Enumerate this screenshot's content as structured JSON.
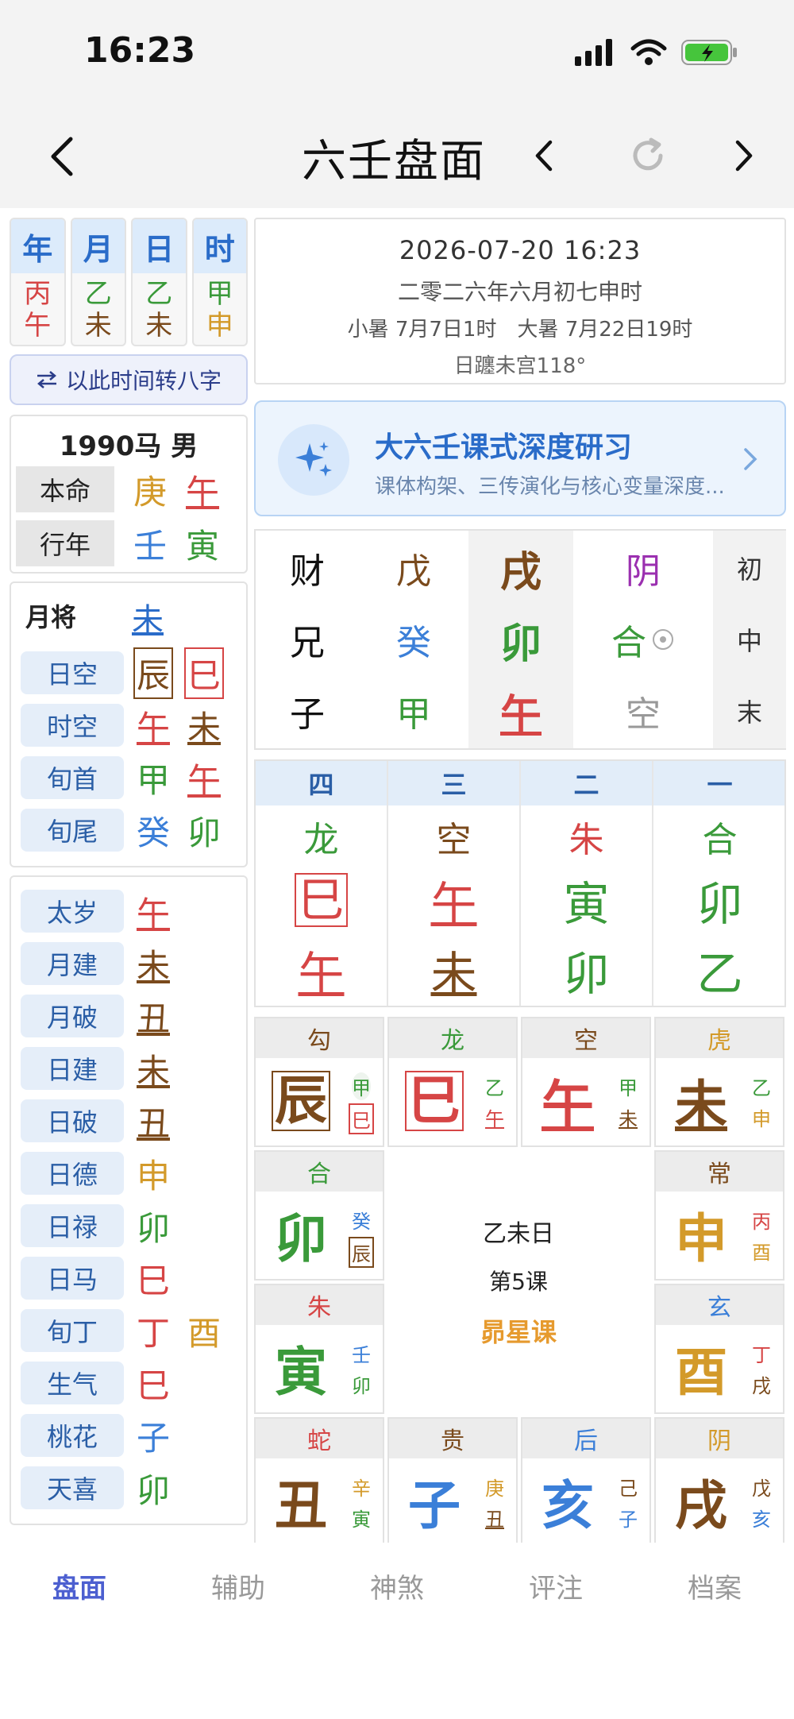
{
  "status": {
    "time": "16:23"
  },
  "nav": {
    "title": "六壬盘面"
  },
  "pillars": [
    {
      "head": "年",
      "gan": "丙",
      "zhi": "午",
      "gan_color": "#d64545",
      "zhi_color": "#d64545"
    },
    {
      "head": "月",
      "gan": "乙",
      "zhi": "未",
      "gan_color": "#3a9a3a",
      "zhi_color": "#7a4a1c"
    },
    {
      "head": "日",
      "gan": "乙",
      "zhi": "未",
      "gan_color": "#3a9a3a",
      "zhi_color": "#7a4a1c"
    },
    {
      "head": "时",
      "gan": "甲",
      "zhi": "申",
      "gan_color": "#3a9a3a",
      "zhi_color": "#d39a2a"
    }
  ],
  "convert_label": "以此时间转八字",
  "birth": {
    "title": "1990马 男",
    "rows": [
      {
        "label": "本命",
        "v1": "庚",
        "v2": "午",
        "c1": "#d39a2a",
        "c2": "#d64545"
      },
      {
        "label": "行年",
        "v1": "壬",
        "v2": "寅",
        "c1": "#3b7fd8",
        "c2": "#3a9a3a"
      }
    ]
  },
  "month_general": {
    "label": "月将",
    "value": "未",
    "rows": [
      {
        "label": "日空",
        "v1": "辰",
        "v2": "巳",
        "c1": "#7a4a1c",
        "c2": "#d64545"
      },
      {
        "label": "时空",
        "v1": "午",
        "v2": "未",
        "c1": "#d64545",
        "c2": "#7a4a1c"
      },
      {
        "label": "旬首",
        "v1": "甲",
        "v2": "午",
        "c1": "#3a9a3a",
        "c2": "#d64545"
      },
      {
        "label": "旬尾",
        "v1": "癸",
        "v2": "卯",
        "c1": "#3b7fd8",
        "c2": "#3a9a3a"
      }
    ]
  },
  "shensha": [
    {
      "label": "太岁",
      "v1": "午",
      "c1": "#d64545"
    },
    {
      "label": "月建",
      "v1": "未",
      "c1": "#7a4a1c"
    },
    {
      "label": "月破",
      "v1": "丑",
      "c1": "#7a4a1c"
    },
    {
      "label": "日建",
      "v1": "未",
      "c1": "#7a4a1c"
    },
    {
      "label": "日破",
      "v1": "丑",
      "c1": "#7a4a1c"
    },
    {
      "label": "日德",
      "v1": "申",
      "c1": "#d39a2a"
    },
    {
      "label": "日禄",
      "v1": "卯",
      "c1": "#3a9a3a"
    },
    {
      "label": "日马",
      "v1": "巳",
      "c1": "#d64545"
    },
    {
      "label": "旬丁",
      "v1": "丁",
      "v2": "酉",
      "c1": "#d64545",
      "c2": "#d39a2a"
    },
    {
      "label": "生气",
      "v1": "巳",
      "c1": "#d64545"
    },
    {
      "label": "桃花",
      "v1": "子",
      "c1": "#3b7fd8"
    },
    {
      "label": "天喜",
      "v1": "卯",
      "c1": "#3a9a3a"
    }
  ],
  "date": {
    "solar": "2026-07-20 16:23",
    "lunar": "二零二六年六月初七申时",
    "terms": "小暑 7月7日1时　大暑 7月22日19时",
    "sun": "日躔未宫118°"
  },
  "promo": {
    "title": "大六壬课式深度研习",
    "subtitle": "课体构架、三传演化与核心变量深度..."
  },
  "sanchuan": [
    {
      "qin": "财",
      "dun": "戊",
      "zhi": "戌",
      "jiang": "阴",
      "pos": "初",
      "dun_c": "#7a4a1c",
      "zhi_c": "#7a4a1c",
      "jiang_c": "#9b30b0"
    },
    {
      "qin": "兄",
      "dun": "癸",
      "zhi": "卯",
      "jiang": "合",
      "pos": "中",
      "dun_c": "#3b7fd8",
      "zhi_c": "#3a9a3a",
      "jiang_c": "#3a9a3a"
    },
    {
      "qin": "子",
      "dun": "甲",
      "zhi": "午",
      "jiang": "空",
      "pos": "末",
      "dun_c": "#3a9a3a",
      "zhi_c": "#d64545",
      "jiang_c": "#999999"
    }
  ],
  "sike": [
    {
      "num": "四",
      "jiang": "龙",
      "top": "巳",
      "bottom": "午",
      "jc": "#3a9a3a",
      "tc": "#d64545",
      "bc": "#d64545"
    },
    {
      "num": "三",
      "jiang": "空",
      "top": "午",
      "bottom": "未",
      "jc": "#7a4a1c",
      "tc": "#d64545",
      "bc": "#7a4a1c"
    },
    {
      "num": "二",
      "jiang": "朱",
      "top": "寅",
      "bottom": "卯",
      "jc": "#d64545",
      "tc": "#3a9a3a",
      "bc": "#3a9a3a"
    },
    {
      "num": "一",
      "jiang": "合",
      "top": "卯",
      "bottom": "乙",
      "jc": "#3a9a3a",
      "tc": "#3a9a3a",
      "bc": "#3a9a3a"
    }
  ],
  "tianpan_center": {
    "day": "乙未日",
    "lesson": "第5课",
    "type": "昴星课"
  },
  "tianpan": [
    {
      "id": "c1",
      "jiang": "勾",
      "big": "辰",
      "s1": "甲",
      "s2": "巳",
      "jc": "#7a4a1c",
      "bc": "#7a4a1c",
      "c1": "#3a9a3a",
      "c2": "#d64545"
    },
    {
      "id": "c2",
      "jiang": "龙",
      "big": "巳",
      "s1": "乙",
      "s2": "午",
      "jc": "#3a9a3a",
      "bc": "#d64545",
      "c1": "#3a9a3a",
      "c2": "#d64545"
    },
    {
      "id": "c3",
      "jiang": "空",
      "big": "午",
      "s1": "甲",
      "s2": "未",
      "jc": "#7a4a1c",
      "bc": "#d64545",
      "c1": "#3a9a3a",
      "c2": "#7a4a1c"
    },
    {
      "id": "c4",
      "jiang": "虎",
      "big": "未",
      "s1": "乙",
      "s2": "申",
      "jc": "#d39a2a",
      "bc": "#7a4a1c",
      "c1": "#3a9a3a",
      "c2": "#d39a2a"
    },
    {
      "id": "c5",
      "jiang": "合",
      "big": "卯",
      "s1": "癸",
      "s2": "辰",
      "jc": "#3a9a3a",
      "bc": "#3a9a3a",
      "c1": "#3b7fd8",
      "c2": "#7a4a1c"
    },
    {
      "id": "c6",
      "jiang": "常",
      "big": "申",
      "s1": "丙",
      "s2": "酉",
      "jc": "#7a4a1c",
      "bc": "#d39a2a",
      "c1": "#d64545",
      "c2": "#d39a2a"
    },
    {
      "id": "c7",
      "jiang": "朱",
      "big": "寅",
      "s1": "壬",
      "s2": "卯",
      "jc": "#d64545",
      "bc": "#3a9a3a",
      "c1": "#3b7fd8",
      "c2": "#3a9a3a"
    },
    {
      "id": "c8",
      "jiang": "玄",
      "big": "酉",
      "s1": "丁",
      "s2": "戌",
      "jc": "#3b7fd8",
      "bc": "#d39a2a",
      "c1": "#d64545",
      "c2": "#7a4a1c"
    },
    {
      "id": "c9",
      "jiang": "蛇",
      "big": "丑",
      "s1": "辛",
      "s2": "寅",
      "jc": "#d64545",
      "bc": "#7a4a1c",
      "c1": "#d39a2a",
      "c2": "#3a9a3a"
    },
    {
      "id": "c10",
      "jiang": "贵",
      "big": "子",
      "s1": "庚",
      "s2": "丑",
      "jc": "#7a4a1c",
      "bc": "#3b7fd8",
      "c1": "#d39a2a",
      "c2": "#7a4a1c"
    },
    {
      "id": "c11",
      "jiang": "后",
      "big": "亥",
      "s1": "己",
      "s2": "子",
      "jc": "#3b7fd8",
      "bc": "#3b7fd8",
      "c1": "#7a4a1c",
      "c2": "#3b7fd8"
    },
    {
      "id": "c12",
      "jiang": "阴",
      "big": "戌",
      "s1": "戊",
      "s2": "亥",
      "jc": "#d39a2a",
      "bc": "#7a4a1c",
      "c1": "#7a4a1c",
      "c2": "#3b7fd8"
    }
  ],
  "tabs": [
    "盘面",
    "辅助",
    "神煞",
    "评注",
    "档案"
  ]
}
